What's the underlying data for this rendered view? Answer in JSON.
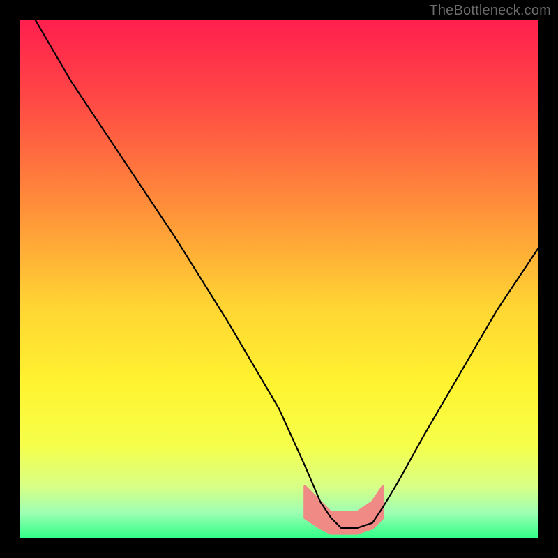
{
  "attribution": "TheBottleneck.com",
  "chart_data": {
    "type": "line",
    "title": "",
    "xlabel": "",
    "ylabel": "",
    "xlim": [
      0,
      100
    ],
    "ylim": [
      0,
      100
    ],
    "grid": false,
    "legend": false,
    "gradient_stops": [
      {
        "offset": 0.0,
        "color": "#ff1f4e"
      },
      {
        "offset": 0.16,
        "color": "#ff4a45"
      },
      {
        "offset": 0.35,
        "color": "#ff8b3a"
      },
      {
        "offset": 0.55,
        "color": "#ffd433"
      },
      {
        "offset": 0.7,
        "color": "#fff330"
      },
      {
        "offset": 0.82,
        "color": "#f6ff4a"
      },
      {
        "offset": 0.9,
        "color": "#d8ff86"
      },
      {
        "offset": 0.95,
        "color": "#9effb3"
      },
      {
        "offset": 1.0,
        "color": "#2eff88"
      }
    ],
    "curve": {
      "x": [
        3,
        10,
        20,
        30,
        40,
        50,
        55,
        58,
        60,
        62,
        65,
        68,
        70,
        73,
        78,
        85,
        92,
        100
      ],
      "y": [
        100,
        88,
        73,
        58,
        42,
        25,
        14,
        7,
        4,
        2,
        2,
        3,
        6,
        11,
        20,
        32,
        44,
        56
      ]
    },
    "marker_band": {
      "x": [
        55,
        58,
        60,
        62,
        65,
        68,
        70
      ],
      "y_lower": [
        4,
        2,
        1,
        1,
        1,
        2,
        4
      ],
      "y_upper": [
        10,
        7,
        5,
        5,
        5,
        7,
        10
      ],
      "color": "#f08a84"
    }
  }
}
